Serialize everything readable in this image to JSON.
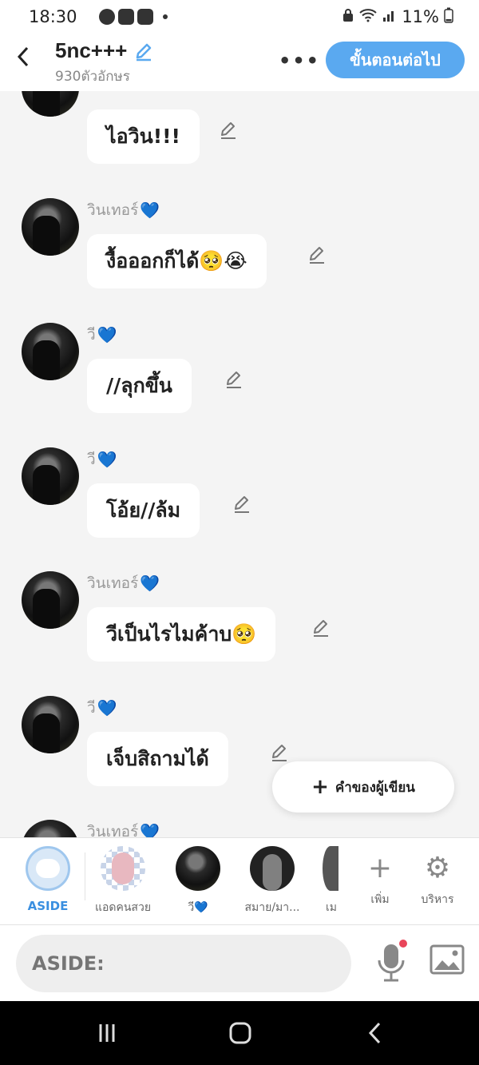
{
  "status": {
    "time": "18:30",
    "battery": "11%"
  },
  "header": {
    "title": "5nc+++",
    "subtitle": "930ตัวอักษร",
    "more": "•••",
    "next_label": "ขั้นตอนต่อไป"
  },
  "messages": [
    {
      "name": "",
      "text": "ไอวิน!!!"
    },
    {
      "name": "วินเทอร์",
      "text": "งื้อออกก็ได้🥺😭"
    },
    {
      "name": "วี",
      "text": "//ลุกขึ้น"
    },
    {
      "name": "วี",
      "text": "โอ้ย//ล้ม"
    },
    {
      "name": "วินเทอร์",
      "text": "วีเป็นไรไมค้าบ🥺"
    },
    {
      "name": "วี",
      "text": "เจ็บสิถามได้"
    },
    {
      "name": "วินเทอร์",
      "text": ""
    }
  ],
  "heart": "💙",
  "fab": {
    "plus": "+",
    "label": "คำของผู้เขียน"
  },
  "characters": {
    "aside": "ASIDE",
    "c1": "แอดคนสวย",
    "c2": "วี💙",
    "c3": "สมาย/มา...",
    "c4": "เม",
    "add_icon": "+",
    "add": "เพิ่ม",
    "manage_icon": "⚙",
    "manage": "บริหาร"
  },
  "input": {
    "placeholder": "ASIDE:"
  },
  "colors": {
    "accent": "#5aa9f0",
    "heart": "#1aa7f5",
    "mic_dot": "#e9455a"
  }
}
